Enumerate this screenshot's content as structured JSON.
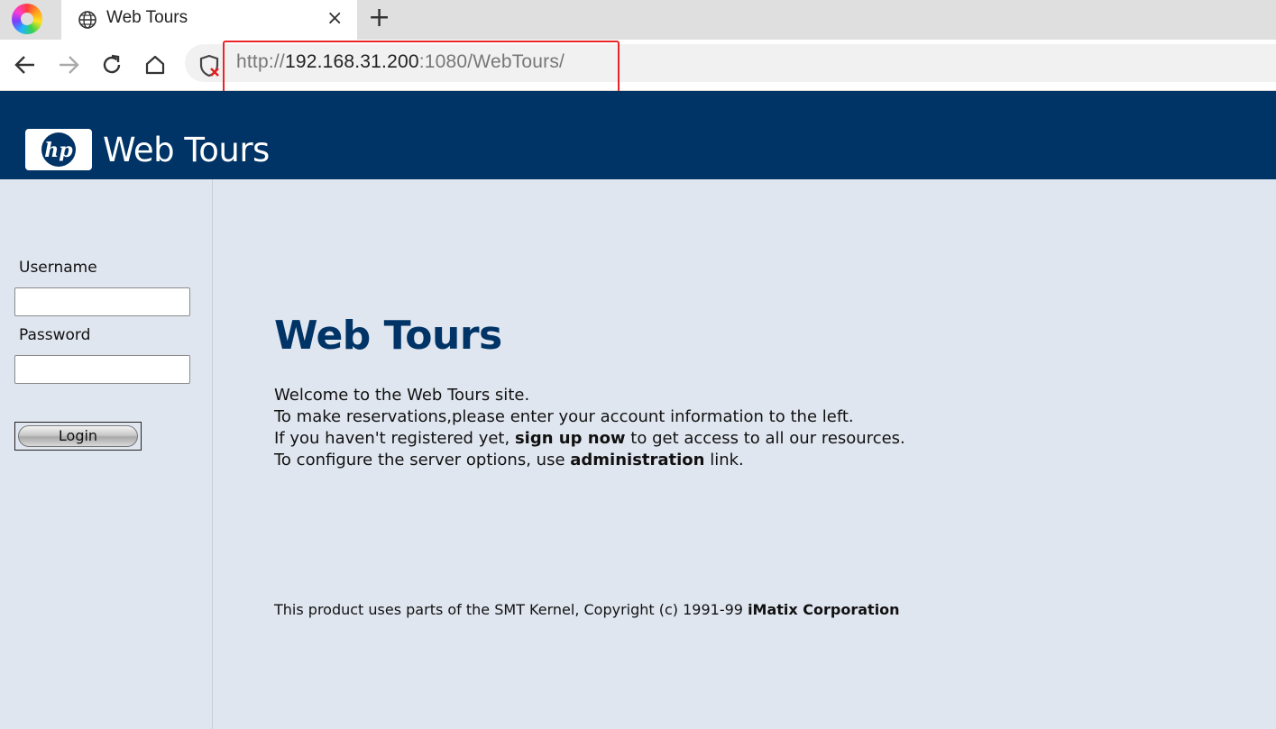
{
  "browser": {
    "tab_title": "Web Tours",
    "tab_close": "×",
    "new_tab": "+",
    "url_scheme": "http://",
    "url_host": "192.168.31.200",
    "url_rest": ":1080/WebTours/"
  },
  "header": {
    "brand": "Web Tours",
    "logo_text": "hp",
    "background": "#003366"
  },
  "login": {
    "username_label": "Username",
    "username_value": "",
    "password_label": "Password",
    "password_value": "",
    "login_label": "Login"
  },
  "main": {
    "title": "Web Tours",
    "line1": "Welcome to the Web Tours site.",
    "line2": "To make reservations,please enter your account information to the left.",
    "line3_pre": "If you haven't registered yet, ",
    "line3_link": "sign up now",
    "line3_post": " to get access to all our resources.",
    "line4_pre": "To configure the server options, use ",
    "line4_link": "administration",
    "line4_post": " link.",
    "footer_pre": "This product uses parts of the SMT Kernel, Copyright (c) 1991-99 ",
    "footer_link": "iMatix Corporation"
  }
}
